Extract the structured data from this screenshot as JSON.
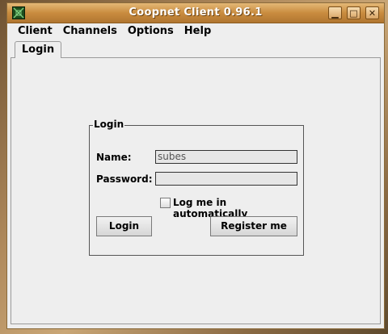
{
  "window": {
    "title": "Coopnet Client 0.96.1",
    "icon": "app-grid-icon",
    "controls": {
      "minimize_glyph": "▁",
      "maximize_glyph": "□",
      "close_glyph": "✕"
    }
  },
  "menubar": {
    "items": [
      "Client",
      "Channels",
      "Options",
      "Help"
    ]
  },
  "tabs": [
    {
      "label": "Login",
      "selected": true
    }
  ],
  "login": {
    "group_title": "Login",
    "name_label": "Name:",
    "name_value": "subes",
    "password_label": "Password:",
    "password_value": "",
    "auto_login_label": "Log me in automatically",
    "auto_login_checked": false,
    "login_button": "Login",
    "register_button": "Register me"
  },
  "colors": {
    "titlebar": "#c98c3f",
    "panel": "#eeeeee",
    "field": "#e6e6e6"
  }
}
